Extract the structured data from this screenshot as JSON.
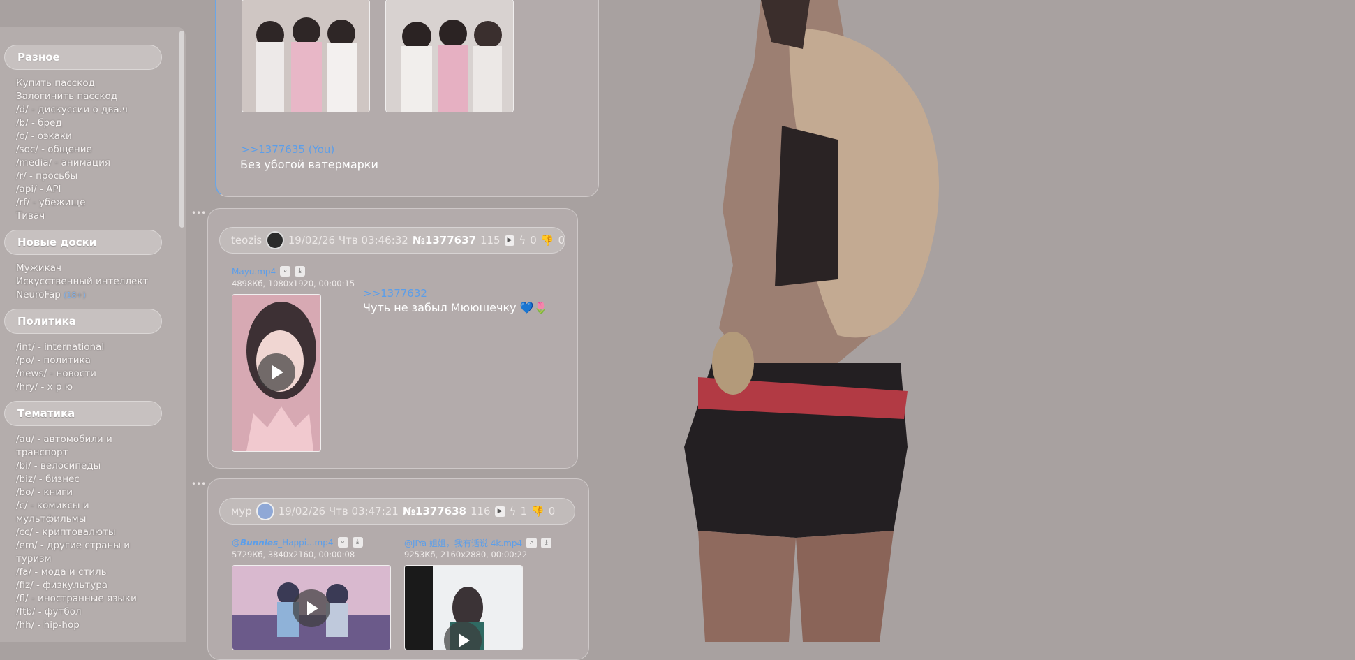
{
  "colors": {
    "page_bg": "#a8a1a0",
    "link": "#5b9eea",
    "text": "#ffffff"
  },
  "sidebar": {
    "sections": [
      {
        "title": "Разное",
        "items": [
          {
            "label": "Купить пасскод"
          },
          {
            "label": "Залогинить пасскод"
          },
          {
            "label": "/d/ - дискуссии о два.ч"
          },
          {
            "label": "/b/ - бред"
          },
          {
            "label": "/o/ - оэкаки"
          },
          {
            "label": "/soc/ - общение"
          },
          {
            "label": "/media/ - анимация"
          },
          {
            "label": "/r/ - просьбы"
          },
          {
            "label": "/api/ - API"
          },
          {
            "label": "/rf/ - убежище"
          },
          {
            "label": "Тивач"
          }
        ]
      },
      {
        "title": "Новые доски",
        "items": [
          {
            "label": "Мужикач"
          },
          {
            "label": "Искусственный интеллект"
          },
          {
            "label": "NeuroFap",
            "tag": "(18+)"
          }
        ]
      },
      {
        "title": "Политика",
        "items": [
          {
            "label": "/int/ - international"
          },
          {
            "label": "/po/ - политика"
          },
          {
            "label": "/news/ - новости"
          },
          {
            "label": "/hry/ - х р ю"
          }
        ]
      },
      {
        "title": "Тематика",
        "items": [
          {
            "label": "/au/ - автомобили и транспорт"
          },
          {
            "label": "/bi/ - велосипеды"
          },
          {
            "label": "/biz/ - бизнес"
          },
          {
            "label": "/bo/ - книги"
          },
          {
            "label": "/c/ - комиксы и мультфильмы"
          },
          {
            "label": "/cc/ - криптовалюты"
          },
          {
            "label": "/em/ - другие страны и туризм"
          },
          {
            "label": "/fa/ - мода и стиль"
          },
          {
            "label": "/fiz/ - физкультура"
          },
          {
            "label": "/fl/ - иностранные языки"
          },
          {
            "label": "/ftb/ - футбол"
          },
          {
            "label": "/hh/ - hip-hop"
          }
        ]
      }
    ]
  },
  "posts": {
    "p1": {
      "reply": ">>1377635 (You)",
      "comment": "Без убогой ватермарки"
    },
    "p2": {
      "name": "teozis",
      "date": "19/02/26 Чтв 03:46:32",
      "num": "№1377637",
      "count": "115",
      "likes": "0",
      "dislikes": "0",
      "file_name": "Mayu.mp4",
      "file_meta": "4898Кб, 1080x1920, 00:00:15",
      "reply": ">>1377632",
      "comment": "Чуть не забыл Мююшечку 💙🌷"
    },
    "p3": {
      "name": "мур",
      "date": "19/02/26 Чтв 03:47:21",
      "num": "№1377638",
      "count": "116",
      "likes": "1",
      "dislikes": "0",
      "file1_name": "@𝘽𝙪𝙣𝙣𝙞𝙚𝙨_Happi...mp4",
      "file1_meta": "5729Кб, 3840x2160, 00:00:08",
      "file2_name": "@JIYa 姐姐，我有话说 4k.mp4",
      "file2_meta": "9253Кб, 2160x2880, 00:00:22"
    }
  }
}
